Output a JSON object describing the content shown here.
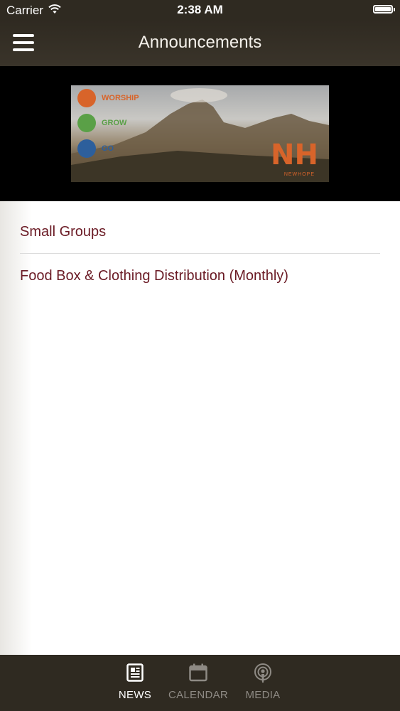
{
  "status_bar": {
    "carrier": "Carrier",
    "time": "2:38 AM"
  },
  "nav": {
    "title": "Announcements"
  },
  "banner": {
    "items": [
      {
        "label": "WORSHIP",
        "color": "#d8642a"
      },
      {
        "label": "GROW",
        "color": "#5aa047"
      },
      {
        "label": "GO",
        "color": "#2d5f9c"
      }
    ],
    "logo": "NH",
    "logo_sub": "NEWHOPE"
  },
  "announcements": [
    "Small Groups",
    "Food Box & Clothing Distribution (Monthly)"
  ],
  "tabs": [
    {
      "label": "NEWS",
      "icon": "newspaper-icon",
      "active": true
    },
    {
      "label": "CALENDAR",
      "icon": "calendar-icon",
      "active": false
    },
    {
      "label": "MEDIA",
      "icon": "podcast-icon",
      "active": false
    }
  ],
  "colors": {
    "bar": "#2f2a21",
    "link": "#6a1a24"
  }
}
